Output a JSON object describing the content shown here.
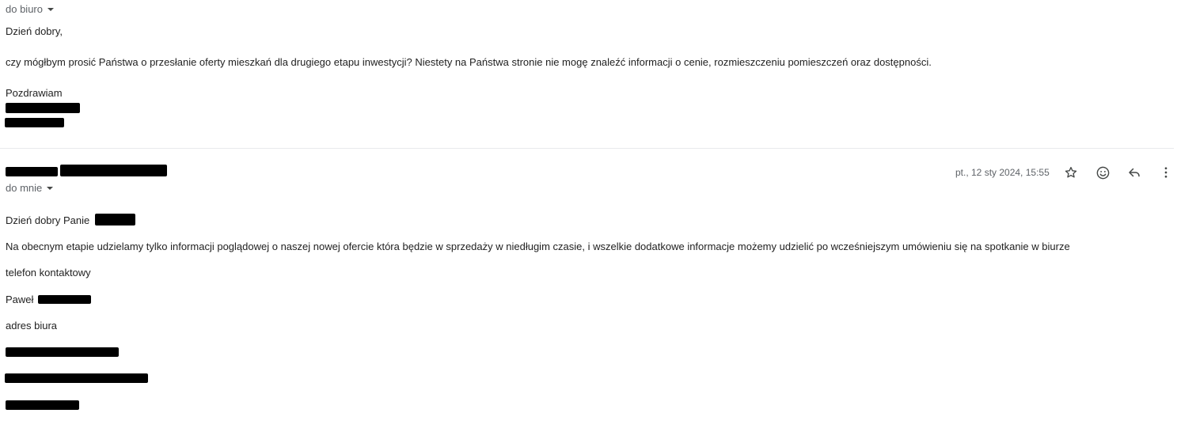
{
  "message1": {
    "recipient": "do biuro",
    "greeting": "Dzień dobry,",
    "body": "czy mógłbym prosić Państwa o przesłanie oferty mieszkań dla drugiego etapu inwestycji? Niestety na Państwa stronie nie mogę znaleźć informacji o cenie, rozmieszczeniu pomieszczeń oraz dostępności.",
    "closing": "Pozdrawiam"
  },
  "message2": {
    "date": "pt., 12 sty 2024, 15:55",
    "recipient": "do mnie",
    "greeting": "Dzień dobry Panie",
    "body": "Na obecnym etapie udzielamy tylko informacji poglądowej o naszej nowej ofercie która będzie w sprzedaży w niedługim czasie, i wszelkie dodatkowe informacje możemy udzielić po wcześniejszym umówieniu się na spotkanie w biurze",
    "phone_label": "telefon kontaktowy",
    "signature_name": "Paweł",
    "address_label": "adres biura"
  },
  "icons": {
    "star": "star-icon",
    "emoji": "emoji-icon",
    "reply": "reply-icon",
    "more": "more-vert-icon"
  }
}
